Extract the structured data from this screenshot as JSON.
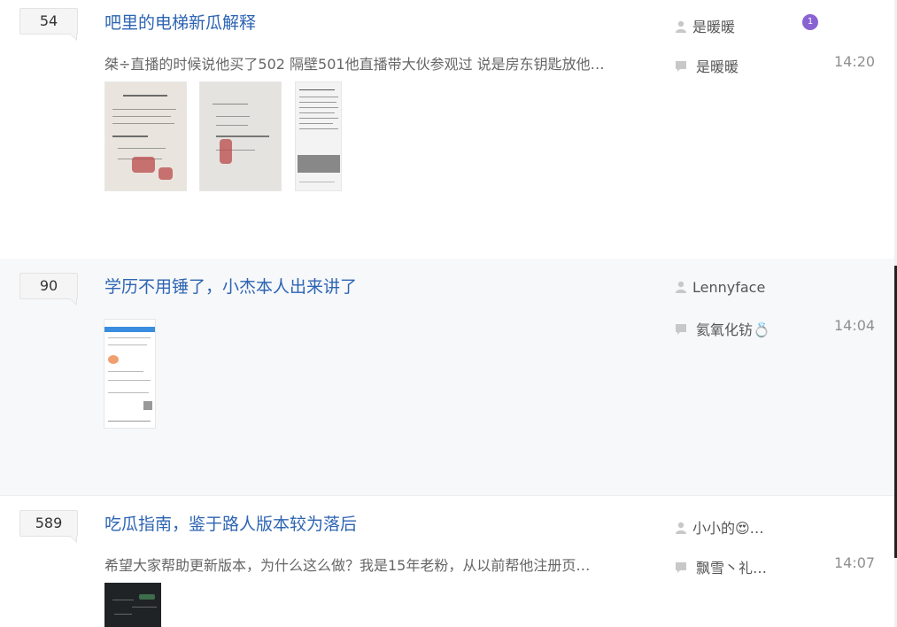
{
  "threads": [
    {
      "reply_count": "54",
      "title": "吧里的电梯新瓜解释",
      "abstract": "桀÷直播的时候说他买了502 隔壁501他直播带大伙参观过 说是房东钥匙放他…",
      "author": "是暖暖",
      "last_replier": "是暖暖",
      "time": "14:20",
      "has_badge": true,
      "badge_text": "1",
      "images": [
        {
          "alt": "document-photo-1"
        },
        {
          "alt": "document-photo-2"
        },
        {
          "alt": "screenshot-article"
        }
      ]
    },
    {
      "reply_count": "90",
      "title": "学历不用锤了，小杰本人出来讲了",
      "abstract": "",
      "author": "Lennyface",
      "last_replier": "氦氧化钫💍",
      "time": "14:04",
      "images": [
        {
          "alt": "phone-screenshot"
        }
      ]
    },
    {
      "reply_count": "589",
      "title": "吃瓜指南，鉴于路人版本较为落后",
      "abstract": "希望大家帮助更新版本，为什么这么做？我是15年老粉，从以前帮他注册页…",
      "author": "小小的😍…",
      "last_replier": "飘雪丶礼…",
      "time": "14:07",
      "images": [
        {
          "alt": "dark-mindmap-screenshot"
        }
      ]
    }
  ],
  "colors": {
    "title_link": "#2d64b3",
    "alt_row_bg": "#f7f8fa",
    "badge": "#8a63d2"
  },
  "icons": {
    "author": "person-icon",
    "reply": "comment-icon"
  }
}
